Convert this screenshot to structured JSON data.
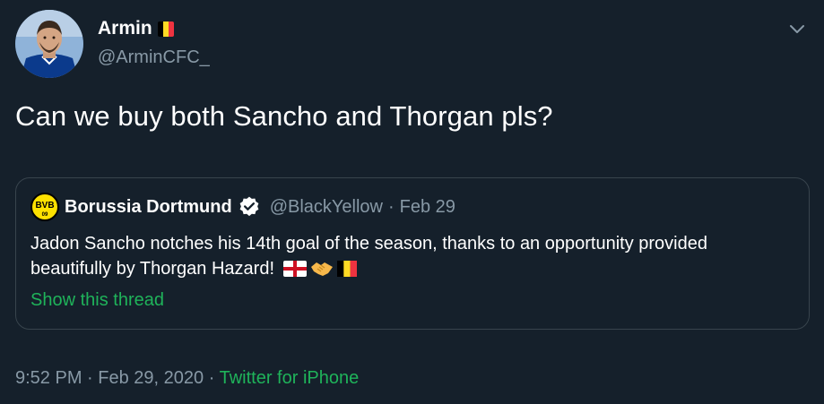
{
  "author": {
    "display_name": "Armin",
    "handle": "@ArminCFC_",
    "flag_emoji": "belgium-flag"
  },
  "tweet": {
    "text": "Can we buy both Sancho and Thorgan pls?"
  },
  "quoted_tweet": {
    "display_name": "Borussia Dortmund",
    "verified": true,
    "handle": "@BlackYellow",
    "separator": "·",
    "date": "Feb 29",
    "text": "Jadon Sancho notches his 14th goal of the season, thanks to an opportunity provided beautifully by Thorgan Hazard!",
    "emojis": [
      "england-flag",
      "handshake",
      "belgium-flag"
    ],
    "show_thread_label": "Show this thread",
    "logo_text": "BVB",
    "logo_number": "09"
  },
  "footer": {
    "time": "9:52 PM",
    "separator": "·",
    "date": "Feb 29, 2020",
    "source": "Twitter for iPhone"
  },
  "colors": {
    "background": "#15202b",
    "secondary_text": "#8899a6",
    "link_green": "#1fb35a",
    "border": "#38444d"
  }
}
